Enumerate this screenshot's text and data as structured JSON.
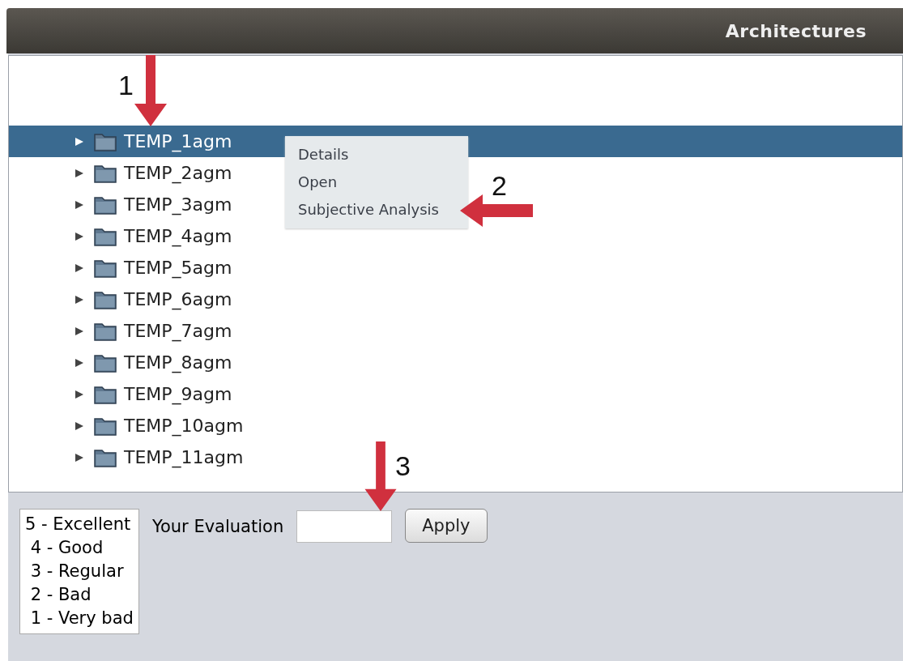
{
  "window": {
    "title": "Architectures"
  },
  "tree": {
    "items": [
      {
        "label": "TEMP_1agm",
        "selected": true,
        "expanded": false
      },
      {
        "label": "TEMP_2agm",
        "selected": false,
        "expanded": false
      },
      {
        "label": "TEMP_3agm",
        "selected": false,
        "expanded": false
      },
      {
        "label": "TEMP_4agm",
        "selected": false,
        "expanded": false
      },
      {
        "label": "TEMP_5agm",
        "selected": false,
        "expanded": false
      },
      {
        "label": "TEMP_6agm",
        "selected": false,
        "expanded": false
      },
      {
        "label": "TEMP_7agm",
        "selected": false,
        "expanded": false
      },
      {
        "label": "TEMP_8agm",
        "selected": false,
        "expanded": false
      },
      {
        "label": "TEMP_9agm",
        "selected": false,
        "expanded": false
      },
      {
        "label": "TEMP_10agm",
        "selected": false,
        "expanded": false
      },
      {
        "label": "TEMP_11agm",
        "selected": false,
        "expanded": false
      }
    ]
  },
  "context_menu": {
    "items": [
      "Details",
      "Open",
      "Subjective Analysis"
    ]
  },
  "legend": [
    "5 - Excellent",
    "4 - Good",
    "3 - Regular",
    "2 - Bad",
    "1 - Very bad"
  ],
  "evaluation": {
    "label": "Your Evaluation"
  },
  "apply_button": "Apply",
  "annotations": [
    {
      "label": "1",
      "kind": "down"
    },
    {
      "label": "2",
      "kind": "left"
    },
    {
      "label": "3",
      "kind": "down"
    }
  ]
}
